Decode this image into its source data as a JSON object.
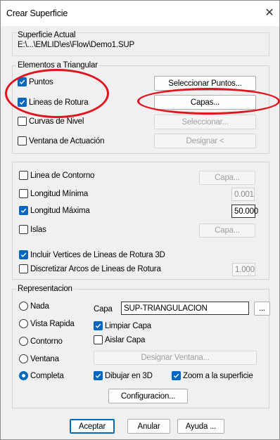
{
  "window": {
    "title": "Crear Superficie",
    "close_glyph": "✕"
  },
  "superficie": {
    "label": "Superficie Actual",
    "path": "E:\\...\\EMLID\\es\\Flow\\Demo1.SUP"
  },
  "elementos": {
    "label": "Elementos a Triangular",
    "puntos": {
      "label": "Puntos",
      "checked": true,
      "button": "Seleccionar Puntos..."
    },
    "lineas": {
      "label": "Lineas de Rotura",
      "checked": true,
      "button": "Capas..."
    },
    "curvas": {
      "label": "Curvas de Nivel",
      "checked": false,
      "button": "Seleccionar..."
    },
    "ventana": {
      "label": "Ventana de Actuación",
      "checked": false,
      "button": "Designar <"
    }
  },
  "opciones": {
    "contorno": {
      "label": "Linea de Contorno",
      "checked": false,
      "button": "Capa..."
    },
    "minima": {
      "label": "Longitud Mínima",
      "checked": false,
      "value": "0.001"
    },
    "maxima": {
      "label": "Longitud Máxima",
      "checked": true,
      "value": "50.000"
    },
    "islas": {
      "label": "Islas",
      "checked": false,
      "button": "Capa..."
    },
    "vertices": {
      "label": "Incluir Vertices de Lineas de Rotura 3D",
      "checked": true
    },
    "arcos": {
      "label": "Discretizar Arcos de Lineas de Rotura",
      "checked": false,
      "value": "1.000"
    }
  },
  "representacion": {
    "label": "Representacion",
    "options": {
      "nada": "Nada",
      "vista": "Vista Rapida",
      "contorno": "Contorno",
      "ventana": "Ventana",
      "completa": "Completa"
    },
    "selected": "Completa",
    "capa_label": "Capa",
    "capa_value": "SUP-TRIANGULACION",
    "capa_browse": "...",
    "limpiar": {
      "label": "Limpiar Capa",
      "checked": true
    },
    "aislar": {
      "label": "Aislar Capa",
      "checked": false
    },
    "designar": "Designar Ventana...",
    "dibujar": {
      "label": "Dibujar en 3D",
      "checked": true
    },
    "zoom": {
      "label": "Zoom a la superficie",
      "checked": true
    }
  },
  "configuracion": "Configuracion...",
  "footer": {
    "aceptar": "Aceptar",
    "anular": "Anular",
    "ayuda": "Ayuda ..."
  },
  "colors": {
    "accent": "#0067c0",
    "annotation": "#e0141e"
  },
  "icons": {
    "check": "check-icon",
    "close": "close-icon"
  }
}
